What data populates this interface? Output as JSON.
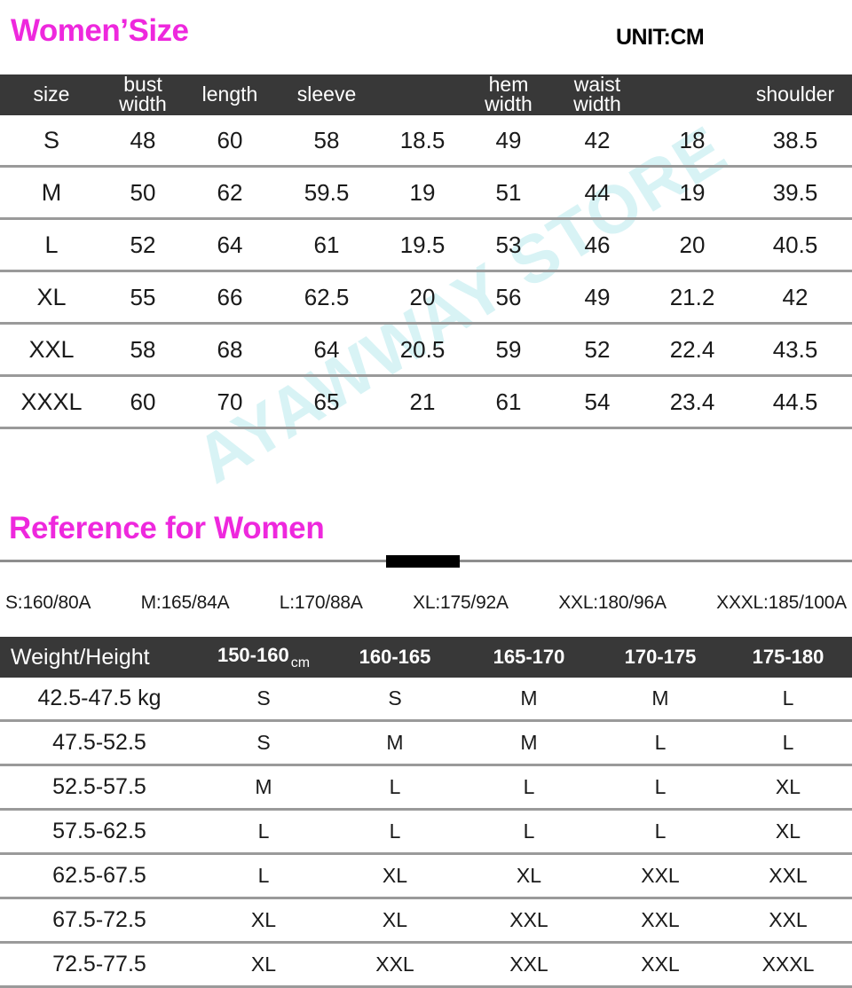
{
  "watermark": {
    "text": "AYAWWAY STORE",
    "color": "#d8f3f5"
  },
  "section1": {
    "title": "Women’Size",
    "title_color": "#ee28dd",
    "unit_label": "UNIT:CM",
    "headers": [
      "size",
      "bust width",
      "length",
      "sleeve",
      "",
      "hem width",
      "waist width",
      "",
      "shoulder"
    ],
    "headers_line1": [
      "size",
      "bust",
      "length",
      "sleeve",
      "",
      "hem",
      "waist",
      "",
      "shoulder"
    ],
    "headers_line2": [
      "",
      "width",
      "",
      "",
      "",
      "width",
      "width",
      "",
      ""
    ],
    "rows": [
      {
        "size": "S",
        "values": [
          "48",
          "60",
          "58",
          "18.5",
          "49",
          "42",
          "18",
          "38.5"
        ]
      },
      {
        "size": "M",
        "values": [
          "50",
          "62",
          "59.5",
          "19",
          "51",
          "44",
          "19",
          "39.5"
        ]
      },
      {
        "size": "L",
        "values": [
          "52",
          "64",
          "61",
          "19.5",
          "53",
          "46",
          "20",
          "40.5"
        ]
      },
      {
        "size": "XL",
        "values": [
          "55",
          "66",
          "62.5",
          "20",
          "56",
          "49",
          "21.2",
          "42"
        ]
      },
      {
        "size": "XXL",
        "values": [
          "58",
          "68",
          "64",
          "20.5",
          "59",
          "52",
          "22.4",
          "43.5"
        ]
      },
      {
        "size": "XXXL",
        "values": [
          "60",
          "70",
          "65",
          "21",
          "61",
          "54",
          "23.4",
          "44.5"
        ]
      }
    ]
  },
  "section2": {
    "title": "Reference for Women",
    "title_color": "#ee28dd",
    "reference_codes": [
      "S:160/80A",
      "M:165/84A",
      "L:170/88A",
      "XL:175/92A",
      "XXL:180/96A",
      "XXXL:185/100A"
    ],
    "table_headers": [
      "Weight/Height",
      "150-160",
      "160-165",
      "165-170",
      "170-175",
      "175-180"
    ],
    "unit_superscript": "cm",
    "rows": [
      {
        "weight": "42.5-47.5 kg",
        "values": [
          "S",
          "S",
          "M",
          "M",
          "L"
        ]
      },
      {
        "weight": "47.5-52.5",
        "values": [
          "S",
          "M",
          "M",
          "L",
          "L"
        ]
      },
      {
        "weight": "52.5-57.5",
        "values": [
          "M",
          "L",
          "L",
          "L",
          "XL"
        ]
      },
      {
        "weight": "57.5-62.5",
        "values": [
          "L",
          "L",
          "L",
          "L",
          "XL"
        ]
      },
      {
        "weight": "62.5-67.5",
        "values": [
          "L",
          "XL",
          "XL",
          "XXL",
          "XXL"
        ]
      },
      {
        "weight": "67.5-72.5",
        "values": [
          "XL",
          "XL",
          "XXL",
          "XXL",
          "XXL"
        ]
      },
      {
        "weight": "72.5-77.5",
        "values": [
          "XL",
          "XXL",
          "XXL",
          "XXL",
          "XXXL"
        ]
      }
    ]
  }
}
